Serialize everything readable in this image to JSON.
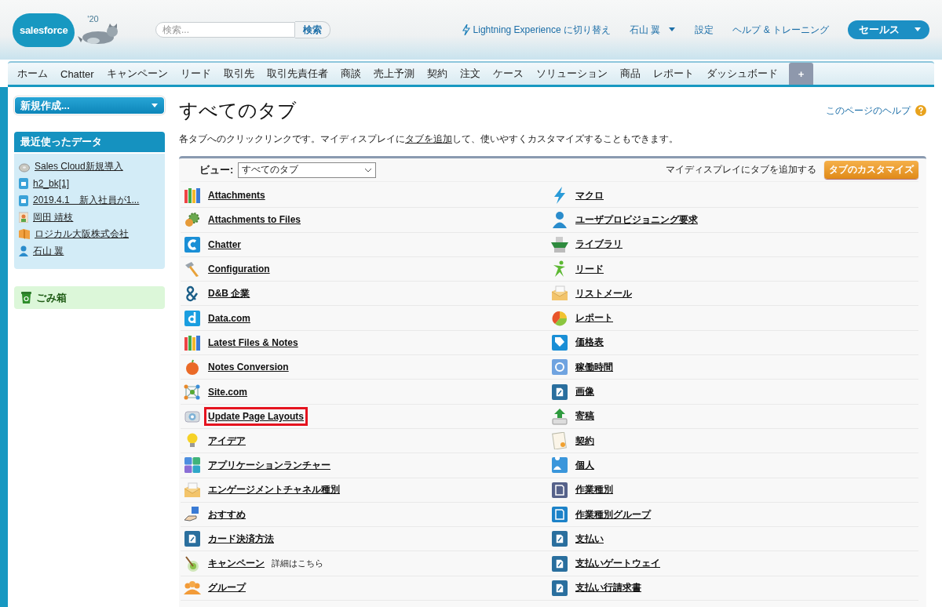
{
  "header": {
    "logo": "salesforce",
    "edition": "'20",
    "search": {
      "placeholder": "検索...",
      "button": "検索"
    },
    "links": [
      {
        "kind": "lightning",
        "label": "Lightning Experience に切り替え"
      },
      {
        "kind": "menu",
        "label": "石山 翼"
      },
      {
        "kind": "plain",
        "label": "設定"
      },
      {
        "kind": "plain",
        "label": "ヘルプ & トレーニング"
      }
    ],
    "app_menu": "セールス"
  },
  "tabs": [
    {
      "label": "ホーム",
      "selected": false
    },
    {
      "label": "Chatter",
      "selected": false
    },
    {
      "label": "キャンペーン",
      "selected": false
    },
    {
      "label": "リード",
      "selected": false
    },
    {
      "label": "取引先",
      "selected": false
    },
    {
      "label": "取引先責任者",
      "selected": false
    },
    {
      "label": "商談",
      "selected": false
    },
    {
      "label": "売上予測",
      "selected": false
    },
    {
      "label": "契約",
      "selected": false
    },
    {
      "label": "注文",
      "selected": false
    },
    {
      "label": "ケース",
      "selected": false
    },
    {
      "label": "ソリューション",
      "selected": false
    },
    {
      "label": "商品",
      "selected": false
    },
    {
      "label": "レポート",
      "selected": false
    },
    {
      "label": "ダッシュボード",
      "selected": false
    },
    {
      "label": "+",
      "selected": true
    }
  ],
  "sidebar": {
    "create_button": "新規作成...",
    "recent": {
      "title": "最近使ったデータ",
      "items": [
        "Sales Cloud新規導入",
        "h2_bk[1]",
        "2019.4.1　新入社員が1...",
        "岡田 靖枝",
        "ロジカル大阪株式会社",
        "石山 翼"
      ]
    },
    "recycle_bin": "ごみ箱"
  },
  "page": {
    "title": "すべてのタブ",
    "help_link": "このページのヘルプ",
    "description": {
      "before": "各タブへのクリックリンクです。マイディスプレイに",
      "link": "タブを追加",
      "after": "して、使いやすくカスタマイズすることもできます。"
    },
    "view": {
      "label": "ビュー:",
      "value": "すべてのタブ",
      "hint": "マイディスプレイにタブを追加する",
      "button": "タブのカスタマイズ"
    },
    "columns": [
      [
        {
          "label": "Attachments",
          "highlighted": false
        },
        {
          "label": "Attachments to Files",
          "highlighted": false
        },
        {
          "label": "Chatter",
          "highlighted": false
        },
        {
          "label": "Configuration",
          "highlighted": false
        },
        {
          "label": "D&B 企業",
          "highlighted": false
        },
        {
          "label": "Data.com",
          "highlighted": false
        },
        {
          "label": "Latest Files & Notes",
          "highlighted": false
        },
        {
          "label": "Notes Conversion",
          "highlighted": false
        },
        {
          "label": "Site.com",
          "highlighted": false
        },
        {
          "label": "Update Page Layouts",
          "highlighted": true
        },
        {
          "label": "アイデア",
          "highlighted": false
        },
        {
          "label": "アプリケーションランチャー",
          "highlighted": false
        },
        {
          "label": "エンゲージメントチャネル種別",
          "highlighted": false
        },
        {
          "label": "おすすめ",
          "highlighted": false
        },
        {
          "label": "カード決済方法",
          "highlighted": false
        },
        {
          "label": "キャンペーン",
          "note": "詳細はこちら",
          "highlighted": false
        },
        {
          "label": "グループ",
          "highlighted": false
        }
      ],
      [
        {
          "label": "マクロ",
          "highlighted": false
        },
        {
          "label": "ユーザプロビジョニング要求",
          "highlighted": false
        },
        {
          "label": "ライブラリ",
          "highlighted": false
        },
        {
          "label": "リード",
          "highlighted": false
        },
        {
          "label": "リストメール",
          "highlighted": false
        },
        {
          "label": "レポート",
          "highlighted": false
        },
        {
          "label": "価格表",
          "highlighted": false
        },
        {
          "label": "稼働時間",
          "highlighted": false
        },
        {
          "label": "画像",
          "highlighted": false
        },
        {
          "label": "寄稿",
          "highlighted": false
        },
        {
          "label": "契約",
          "highlighted": false
        },
        {
          "label": "個人",
          "highlighted": false
        },
        {
          "label": "作業種別",
          "highlighted": false
        },
        {
          "label": "作業種別グループ",
          "highlighted": false
        },
        {
          "label": "支払い",
          "highlighted": false
        },
        {
          "label": "支払いゲートウェイ",
          "highlighted": false
        },
        {
          "label": "支払い行請求書",
          "highlighted": false
        }
      ]
    ]
  }
}
